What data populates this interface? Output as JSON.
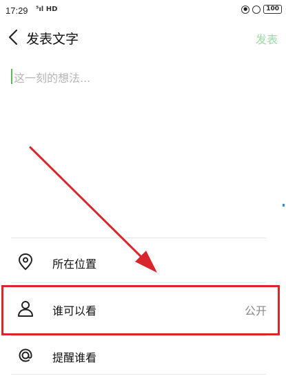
{
  "status_bar": {
    "time": "17:29",
    "signal": "⁵ıl HD",
    "battery": "100"
  },
  "header": {
    "title": "发表文字",
    "publish_label": "发表"
  },
  "editor": {
    "placeholder": "这一刻的想法..."
  },
  "options": [
    {
      "label": "所在位置",
      "value": "",
      "icon": "location-pin-icon"
    },
    {
      "label": "谁可以看",
      "value": "公开",
      "icon": "person-icon"
    },
    {
      "label": "提醒谁看",
      "value": "",
      "icon": "at-sign-icon"
    }
  ],
  "colors": {
    "publish_disabled": "#9fd8a8",
    "annotation_red": "#d9262c",
    "caret": "#5bb85d"
  }
}
